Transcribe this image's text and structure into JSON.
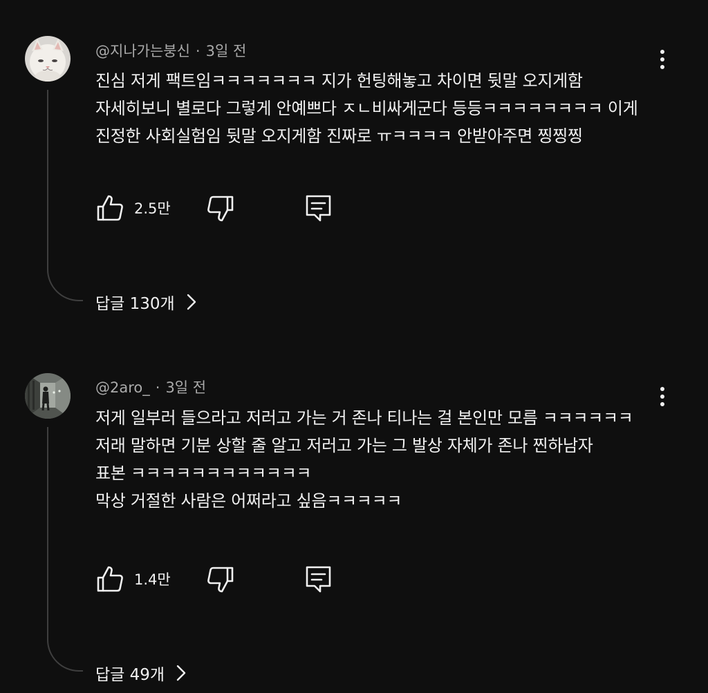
{
  "comments": [
    {
      "author": "@지나가는붕신",
      "separator": "·",
      "time": "3일 전",
      "lines": [
        "진심 저게 팩트임ㅋㅋㅋㅋㅋㅋㅋ 지가 헌팅해놓고 차이면 뒷말 오지게함",
        "자세히보니 별로다 그렇게 안예쁘다 ㅈㄴ비싸게군다 등등ㅋㅋㅋㅋㅋㅋㅋㅋ 이게",
        "진정한 사회실험임 뒷말 오지게함 진짜로 ㅠㅋㅋㅋㅋ 안받아주면 찡찡찡"
      ],
      "likes": "2.5만",
      "replies": "답글 130개",
      "avatar_icon": "white-cat-avatar"
    },
    {
      "author": "@2aro_",
      "separator": "·",
      "time": "3일 전",
      "lines": [
        "저게 일부러 들으라고 저러고 가는 거 존나 티나는 걸 본인만 모름 ㅋㅋㅋㅋㅋㅋ",
        "저래 말하면 기분 상할 줄 알고 저러고 가는 그 발상 자체가 존나 찐하남자",
        "표본 ㅋㅋㅋㅋㅋㅋㅋㅋㅋㅋㅋㅋ",
        "막상 거절한 사람은 어쩌라고 싶음ㅋㅋㅋㅋㅋ"
      ],
      "likes": "1.4만",
      "replies": "답글 49개",
      "avatar_icon": "person-in-corridor-avatar"
    }
  ],
  "colors": {
    "background": "#0f0f0f",
    "text": "#f1f1f1",
    "secondary_text": "#aaaaaa",
    "thread_line": "#3f3f3f"
  },
  "icons": [
    "like-icon",
    "dislike-icon",
    "reply-icon",
    "more-vert-icon",
    "chevron-right-icon"
  ]
}
